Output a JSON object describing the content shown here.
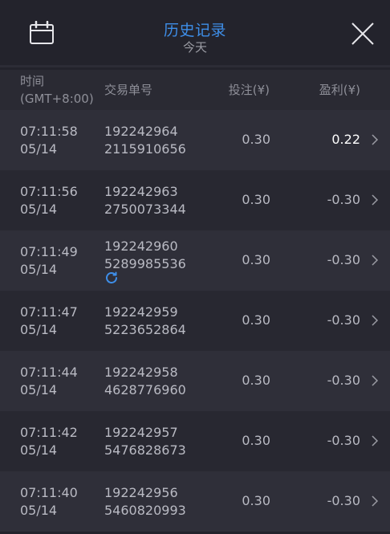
{
  "header": {
    "title": "历史记录",
    "subtitle": "今天",
    "calendar_icon": "calendar-icon",
    "close_icon": "close-icon",
    "accent": "#3e8ee8"
  },
  "columns": {
    "time_line1": "时间",
    "time_line2": "(GMT+8:00)",
    "order": "交易单号",
    "bet": "投注(¥)",
    "profit": "盈利(¥)"
  },
  "rows": [
    {
      "time": "07:11:58",
      "date": "05/14",
      "order1": "192242964",
      "order2": "2115910656",
      "bet": "0.30",
      "profit": "0.22",
      "win": true,
      "pending": false
    },
    {
      "time": "07:11:56",
      "date": "05/14",
      "order1": "192242963",
      "order2": "2750073344",
      "bet": "0.30",
      "profit": "-0.30",
      "win": false,
      "pending": false
    },
    {
      "time": "07:11:49",
      "date": "05/14",
      "order1": "192242960",
      "order2": "5289985536",
      "bet": "0.30",
      "profit": "-0.30",
      "win": false,
      "pending": true
    },
    {
      "time": "07:11:47",
      "date": "05/14",
      "order1": "192242959",
      "order2": "5223652864",
      "bet": "0.30",
      "profit": "-0.30",
      "win": false,
      "pending": false
    },
    {
      "time": "07:11:44",
      "date": "05/14",
      "order1": "192242958",
      "order2": "4628776960",
      "bet": "0.30",
      "profit": "-0.30",
      "win": false,
      "pending": false
    },
    {
      "time": "07:11:42",
      "date": "05/14",
      "order1": "192242957",
      "order2": "5476828673",
      "bet": "0.30",
      "profit": "-0.30",
      "win": false,
      "pending": false
    },
    {
      "time": "07:11:40",
      "date": "05/14",
      "order1": "192242956",
      "order2": "5460820993",
      "bet": "0.30",
      "profit": "-0.30",
      "win": false,
      "pending": false
    }
  ]
}
